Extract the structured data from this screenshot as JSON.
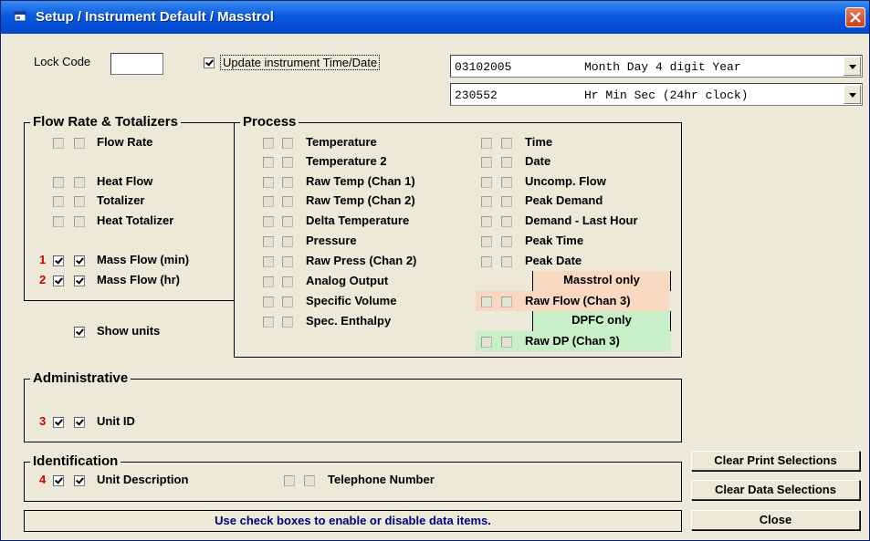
{
  "window": {
    "title": "Setup / Instrument Default / Masstrol"
  },
  "lock_code": {
    "label": "Lock Code",
    "value": ""
  },
  "update_time": {
    "label": "Update instrument Time/Date",
    "checked": true
  },
  "date_combo": {
    "value": "03102005",
    "description": "Month Day 4 digit Year"
  },
  "time_combo": {
    "value": "230552",
    "description": "Hr Min Sec (24hr clock)"
  },
  "flow_group": {
    "title": "Flow Rate & Totalizers",
    "items": {
      "flow_rate": "Flow Rate",
      "heat_flow": "Heat Flow",
      "totalizer": "Totalizer",
      "heat_totalizer": "Heat Totalizer",
      "mass_flow_min": "Mass Flow (min)",
      "mass_flow_hr": "Mass Flow (hr)"
    },
    "badges": {
      "mass_flow_min": "1",
      "mass_flow_hr": "2"
    }
  },
  "show_units": {
    "label": "Show units",
    "checked": true
  },
  "process_group": {
    "title": "Process",
    "left": {
      "temperature": "Temperature",
      "temperature2": "Temperature 2",
      "raw_temp1": "Raw Temp (Chan 1)",
      "raw_temp2": "Raw Temp (Chan 2)",
      "delta_temp": "Delta Temperature",
      "pressure": "Pressure",
      "raw_press2": "Raw Press (Chan 2)",
      "analog_output": "Analog Output",
      "specific_volume": "Specific Volume",
      "spec_enthalpy": "Spec. Enthalpy"
    },
    "right": {
      "time": "Time",
      "date": "Date",
      "uncomp_flow": "Uncomp. Flow",
      "peak_demand": "Peak Demand",
      "demand_last_hour": "Demand - Last Hour",
      "peak_time": "Peak Time",
      "peak_date": "Peak Date",
      "raw_flow3": "Raw Flow (Chan 3)",
      "raw_dp3": "Raw DP (Chan 3)"
    },
    "masstrol_only": "Masstrol only",
    "dpfc_only": "DPFC only",
    "masstrol_color": "#f8d8c0",
    "dpfc_color": "#c8f0c8"
  },
  "admin_group": {
    "title": "Administrative",
    "unit_id": "Unit ID",
    "badge": "3"
  },
  "ident_group": {
    "title": "Identification",
    "unit_description": "Unit Description",
    "telephone": "Telephone Number",
    "badge": "4"
  },
  "buttons": {
    "clear_print": "Clear Print Selections",
    "clear_data": "Clear Data Selections",
    "close": "Close"
  },
  "status": "Use check boxes to enable or disable data items.",
  "colors": {
    "title_bar": "#0a5ae0",
    "badge": "#cc0000",
    "status_text": "#000080"
  }
}
